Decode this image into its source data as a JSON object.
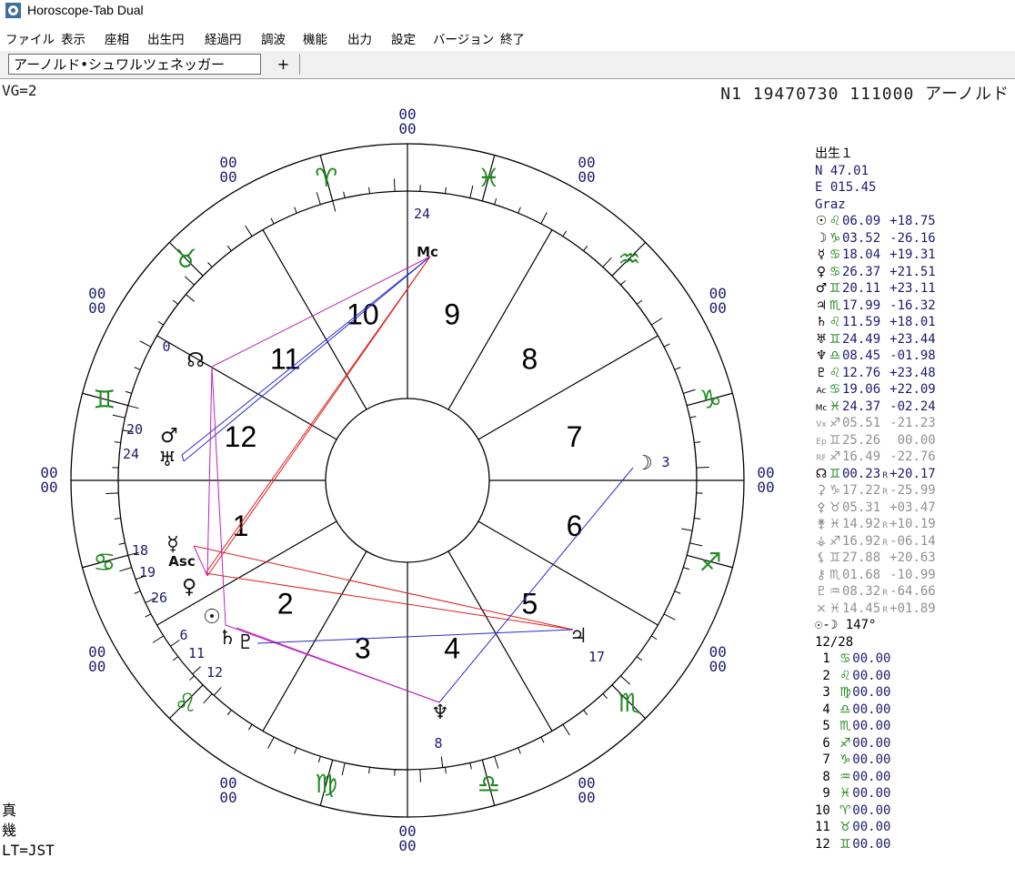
{
  "window": {
    "title": "Horoscope-Tab Dual"
  },
  "menu": [
    "ファイル",
    "表示",
    "座相",
    "出生円",
    "経過円",
    "調波",
    "機能",
    "出力",
    "設定",
    "バージョン",
    "終了"
  ],
  "tabs": {
    "active": "アーノルド•シュワルツェネッガー",
    "add": "+"
  },
  "header": {
    "vg": "VG=2",
    "record": "N1 19470730 111000 アーノルド"
  },
  "footer": {
    "line1": "真",
    "line2": "幾",
    "line3": "LT=JST"
  },
  "chart": {
    "axis_marks": "00",
    "houses": [
      "1",
      "2",
      "3",
      "4",
      "5",
      "6",
      "7",
      "8",
      "9",
      "10",
      "11",
      "12"
    ],
    "signs": [
      "aries",
      "taurus",
      "gemini",
      "cancer",
      "leo",
      "virgo",
      "libra",
      "scorpio",
      "sagittarius",
      "capricorn",
      "aquarius",
      "pisces"
    ],
    "planet_degrees": {
      "mc": "24",
      "node": "0",
      "mars": "20",
      "uranus": "24",
      "mercury": "18",
      "asc": "19",
      "venus": "26",
      "sun": "6",
      "saturn": "11",
      "pluto": "12",
      "moon": "3",
      "jupiter": "17",
      "neptune": "8"
    },
    "colors": {
      "sign_glyph": "#1f8a1f",
      "house_num": "#000000",
      "aspect_red": "#e02020",
      "aspect_blue": "#2a2ad0",
      "aspect_magenta": "#c020c0",
      "label": "#1b1b6e"
    }
  },
  "side": {
    "heading": "出生１",
    "lat": "N  47.01",
    "lon": "E 015.45",
    "place": "Graz",
    "planets": [
      {
        "glyph": "☉",
        "sign": "♌",
        "pos": "06.09",
        "r": "",
        "decl": "+18.75",
        "style": "dark"
      },
      {
        "glyph": "☽",
        "sign": "♑",
        "pos": "03.52",
        "r": "",
        "decl": "-26.16",
        "style": "dark"
      },
      {
        "glyph": "☿",
        "sign": "♋",
        "pos": "18.04",
        "r": "",
        "decl": "+19.31",
        "style": "dark"
      },
      {
        "glyph": "♀",
        "sign": "♋",
        "pos": "26.37",
        "r": "",
        "decl": "+21.51",
        "style": "dark"
      },
      {
        "glyph": "♂",
        "sign": "♊",
        "pos": "20.11",
        "r": "",
        "decl": "+23.11",
        "style": "dark"
      },
      {
        "glyph": "♃",
        "sign": "♏",
        "pos": "17.99",
        "r": "",
        "decl": "-16.32",
        "style": "dark"
      },
      {
        "glyph": "♄",
        "sign": "♌",
        "pos": "11.59",
        "r": "",
        "decl": "+18.01",
        "style": "dark"
      },
      {
        "glyph": "♅",
        "sign": "♊",
        "pos": "24.49",
        "r": "",
        "decl": "+23.44",
        "style": "dark"
      },
      {
        "glyph": "♆",
        "sign": "♎",
        "pos": "08.45",
        "r": "",
        "decl": "-01.98",
        "style": "dark"
      },
      {
        "glyph": "♇",
        "sign": "♌",
        "pos": "12.76",
        "r": "",
        "decl": "+23.48",
        "style": "dark"
      },
      {
        "glyph": "Ac",
        "sign": "♋",
        "pos": "19.06",
        "r": "",
        "decl": "+22.09",
        "style": "dark"
      },
      {
        "glyph": "Mc",
        "sign": "♓",
        "pos": "24.37",
        "r": "",
        "decl": "-02.24",
        "style": "dark"
      },
      {
        "glyph": "Vx",
        "sign": "♐",
        "pos": "05.51",
        "r": "",
        "decl": "-21.23",
        "style": "grey"
      },
      {
        "glyph": "Ep",
        "sign": "♊",
        "pos": "25.26",
        "r": "",
        "decl": " 00.00",
        "style": "grey"
      },
      {
        "glyph": "RF",
        "sign": "♐",
        "pos": "16.49",
        "r": "",
        "decl": "-22.76",
        "style": "grey"
      },
      {
        "glyph": "☊",
        "sign": "♊",
        "pos": "00.23",
        "r": "R",
        "decl": "+20.17",
        "style": "dark"
      },
      {
        "glyph": "⚳",
        "sign": "♑",
        "pos": "17.22",
        "r": "R",
        "decl": "-25.99",
        "style": "grey"
      },
      {
        "glyph": "⚴",
        "sign": "♉",
        "pos": "05.31",
        "r": "",
        "decl": "+03.47",
        "style": "grey"
      },
      {
        "glyph": "⚵",
        "sign": "♓",
        "pos": "14.92",
        "r": "R",
        "decl": "+10.19",
        "style": "grey"
      },
      {
        "glyph": "⚶",
        "sign": "♐",
        "pos": "16.92",
        "r": "R",
        "decl": "-06.14",
        "style": "grey"
      },
      {
        "glyph": "⚸",
        "sign": "♊",
        "pos": "27.88",
        "r": "",
        "decl": "+20.63",
        "style": "grey"
      },
      {
        "glyph": "⚷",
        "sign": "♏",
        "pos": "01.68",
        "r": "",
        "decl": "-10.99",
        "style": "grey"
      },
      {
        "glyph": "♇",
        "sign": "♒",
        "pos": "08.32",
        "r": "R",
        "decl": "-64.66",
        "style": "grey"
      },
      {
        "glyph": "×",
        "sign": "♓",
        "pos": "14.45",
        "r": "R",
        "decl": "+01.89",
        "style": "grey"
      }
    ],
    "phase": "☉-☽ 147°",
    "phase_day": "12/28",
    "cusps": [
      {
        "n": " 1",
        "sign": "♋",
        "pos": "00.00"
      },
      {
        "n": " 2",
        "sign": "♌",
        "pos": "00.00"
      },
      {
        "n": " 3",
        "sign": "♍",
        "pos": "00.00"
      },
      {
        "n": " 4",
        "sign": "♎",
        "pos": "00.00"
      },
      {
        "n": " 5",
        "sign": "♏",
        "pos": "00.00"
      },
      {
        "n": " 6",
        "sign": "♐",
        "pos": "00.00"
      },
      {
        "n": " 7",
        "sign": "♑",
        "pos": "00.00"
      },
      {
        "n": " 8",
        "sign": "♒",
        "pos": "00.00"
      },
      {
        "n": " 9",
        "sign": "♓",
        "pos": "00.00"
      },
      {
        "n": "10",
        "sign": "♈",
        "pos": "00.00"
      },
      {
        "n": "11",
        "sign": "♉",
        "pos": "00.00"
      },
      {
        "n": "12",
        "sign": "♊",
        "pos": "00.00"
      }
    ]
  }
}
